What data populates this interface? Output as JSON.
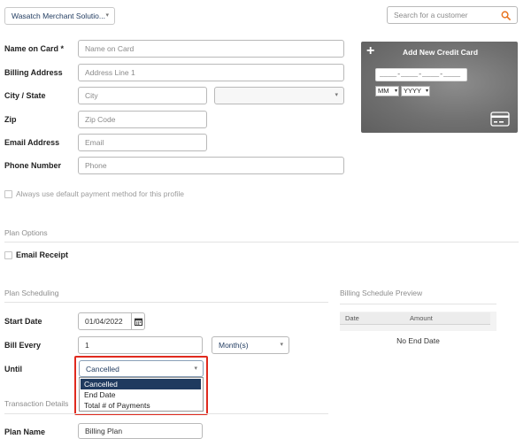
{
  "header": {
    "merchant_select": "Wasatch Merchant Solutio...",
    "search_placeholder": "Search for a customer"
  },
  "form": {
    "name_on_card": {
      "label": "Name on Card *",
      "placeholder": "Name on Card"
    },
    "billing_address": {
      "label": "Billing Address",
      "placeholder": "Address Line 1"
    },
    "city_state": {
      "label": "City / State",
      "city_placeholder": "City",
      "state_value": ""
    },
    "zip": {
      "label": "Zip",
      "placeholder": "Zip Code"
    },
    "email": {
      "label": "Email Address",
      "placeholder": "Email"
    },
    "phone": {
      "label": "Phone Number",
      "placeholder": "Phone"
    },
    "default_payment_label": "Always use default payment method for this profile"
  },
  "credit_card": {
    "title": "Add New Credit Card",
    "number_placeholder": "____-____-____-____",
    "month": "MM",
    "year": "YYYY"
  },
  "plan_options": {
    "title": "Plan Options",
    "email_receipt_label": "Email Receipt"
  },
  "plan_scheduling": {
    "title": "Plan Scheduling",
    "start_date_label": "Start Date",
    "start_date_value": "01/04/2022",
    "bill_every_label": "Bill Every",
    "bill_every_value": "1",
    "interval_value": "Month(s)",
    "until_label": "Until",
    "until_value": "Cancelled",
    "until_options": [
      "Cancelled",
      "End Date",
      "Total # of Payments"
    ]
  },
  "billing_preview": {
    "title": "Billing Schedule Preview",
    "col_date": "Date",
    "col_amount": "Amount",
    "empty_text": "No End Date"
  },
  "transaction_details": {
    "title": "Transaction Details",
    "plan_name_label": "Plan Name",
    "plan_name_value": "Billing Plan"
  },
  "colors": {
    "highlight_border": "#e02a1e",
    "selected_option_bg": "#1f3a5f",
    "accent_orange": "#e8731f",
    "link_blue": "#1f3a5f"
  }
}
